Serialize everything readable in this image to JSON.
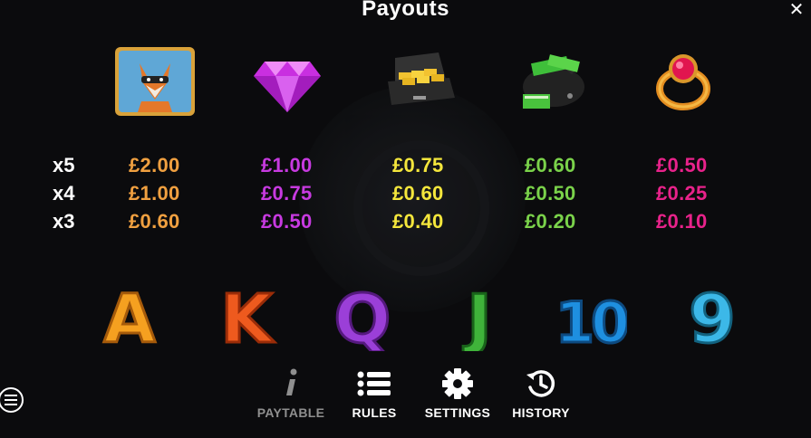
{
  "header": {
    "title": "Payouts",
    "close_label": "✕"
  },
  "symbols": [
    {
      "name": "fox",
      "payouts": [
        "£2.00",
        "£1.00",
        "£0.60"
      ],
      "color": "#f0a040"
    },
    {
      "name": "diamond",
      "payouts": [
        "£1.00",
        "£0.75",
        "£0.50"
      ],
      "color": "#c73ae0"
    },
    {
      "name": "gold-briefcase",
      "payouts": [
        "£0.75",
        "£0.60",
        "£0.40"
      ],
      "color": "#f4e63c"
    },
    {
      "name": "money-bag",
      "payouts": [
        "£0.60",
        "£0.50",
        "£0.20"
      ],
      "color": "#7ad24a"
    },
    {
      "name": "ruby-ring",
      "payouts": [
        "£0.50",
        "£0.25",
        "£0.10"
      ],
      "color": "#e8228a"
    }
  ],
  "multipliers": [
    "x5",
    "x4",
    "x3"
  ],
  "low_symbols": [
    {
      "label": "A",
      "color": "#f5a020"
    },
    {
      "label": "K",
      "color": "#ee5a1e"
    },
    {
      "label": "Q",
      "color": "#9b3fd8"
    },
    {
      "label": "J",
      "color": "#3fb33a"
    },
    {
      "label": "10",
      "color": "#1e8fe0"
    },
    {
      "label": "9",
      "color": "#3cb8e8"
    }
  ],
  "nav": {
    "paytable": {
      "label": "PAYTABLE",
      "icon": "info-icon"
    },
    "rules": {
      "label": "RULES",
      "icon": "list-icon"
    },
    "settings": {
      "label": "SETTINGS",
      "icon": "gear-icon"
    },
    "history": {
      "label": "HISTORY",
      "icon": "history-icon"
    }
  }
}
